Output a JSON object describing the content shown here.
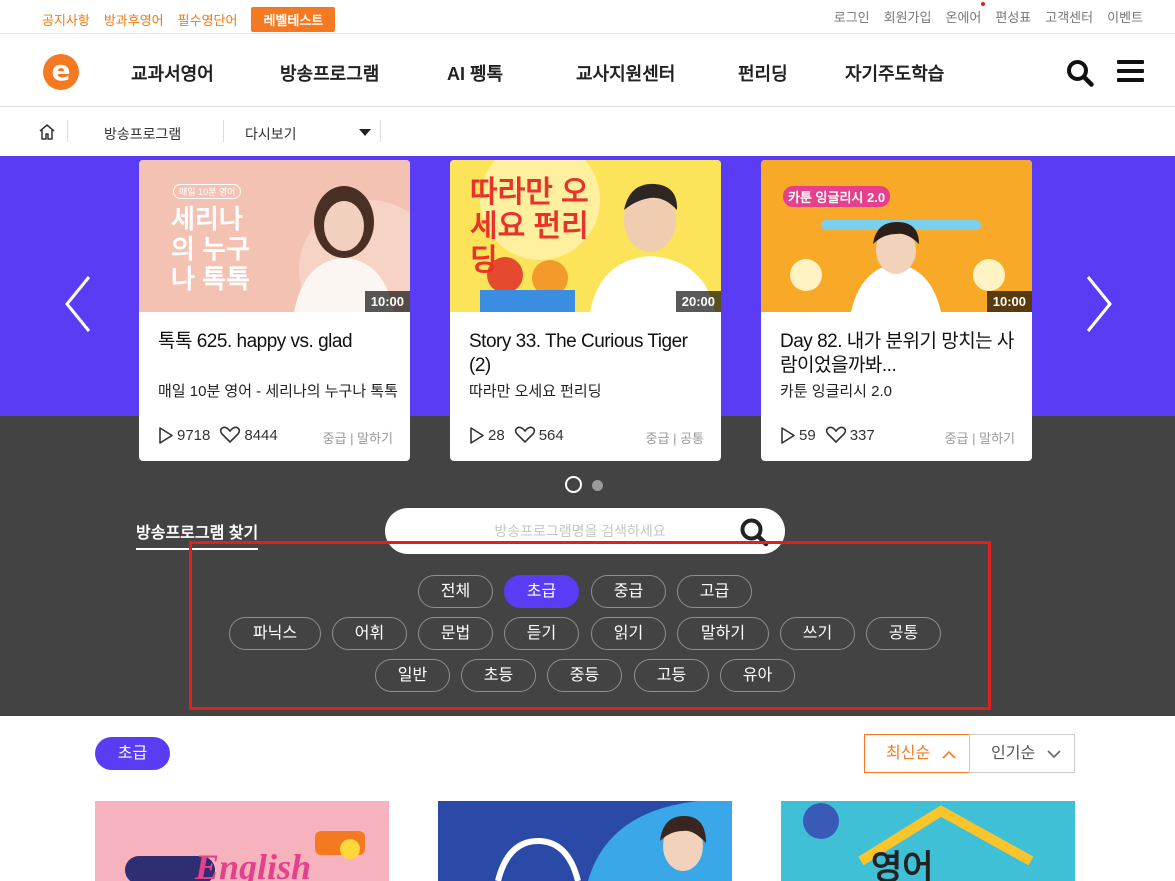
{
  "util": {
    "left_links": [
      "공지사항",
      "방과후영어",
      "필수영단어"
    ],
    "level_test": "레벨테스트",
    "right_links": [
      "로그인",
      "회원가입",
      "온에어",
      "편성표",
      "고객센터",
      "이벤트"
    ]
  },
  "logo": "e",
  "nav": [
    "교과서영어",
    "방송프로그램",
    "AI 펭톡",
    "교사지원센터",
    "펀리딩",
    "자기주도학습"
  ],
  "breadcrumb": {
    "section": "방송프로그램",
    "page": "다시보기"
  },
  "cards": [
    {
      "thumb_badge": "매일 10분 영어",
      "thumb_title": "세리나의 누구나 톡톡",
      "duration": "10:00",
      "title": "톡톡 625. happy vs. glad",
      "subtitle": "매일 10분 영어 - 세리나의 누구나 톡톡",
      "plays": "9718",
      "likes": "8444",
      "level": "중급",
      "category": "말하기"
    },
    {
      "thumb_title": "따라만 오세요 펀리딩",
      "duration": "20:00",
      "title": "Story 33. The Curious Tiger (2)",
      "subtitle": "따라만 오세요 펀리딩",
      "plays": "28",
      "likes": "564",
      "level": "중급",
      "category": "공통"
    },
    {
      "thumb_title": "카툰 잉글리시 2.0",
      "duration": "10:00",
      "title": "Day 82. 내가 분위기 망치는 사람이었을까봐...",
      "subtitle": "카툰 잉글리시 2.0",
      "plays": "59",
      "likes": "337",
      "level": "중급",
      "category": "말하기"
    }
  ],
  "finder": {
    "label": "방송프로그램 찾기",
    "placeholder": "방송프로그램명을 검색하세요"
  },
  "filters": {
    "levels": [
      "전체",
      "초급",
      "중급",
      "고급"
    ],
    "skills": [
      "파닉스",
      "어휘",
      "문법",
      "듣기",
      "읽기",
      "말하기",
      "쓰기",
      "공통"
    ],
    "targets": [
      "일반",
      "초등",
      "중등",
      "고등",
      "유아"
    ],
    "selected": "초급"
  },
  "list": {
    "badge": "초급",
    "sort_latest": "최신순",
    "sort_popular": "인기순"
  },
  "colors": {
    "brand_orange": "#f47920",
    "accent_purple": "#5a3cf5",
    "dark_panel": "#444343",
    "highlight_red": "#e0201f"
  }
}
